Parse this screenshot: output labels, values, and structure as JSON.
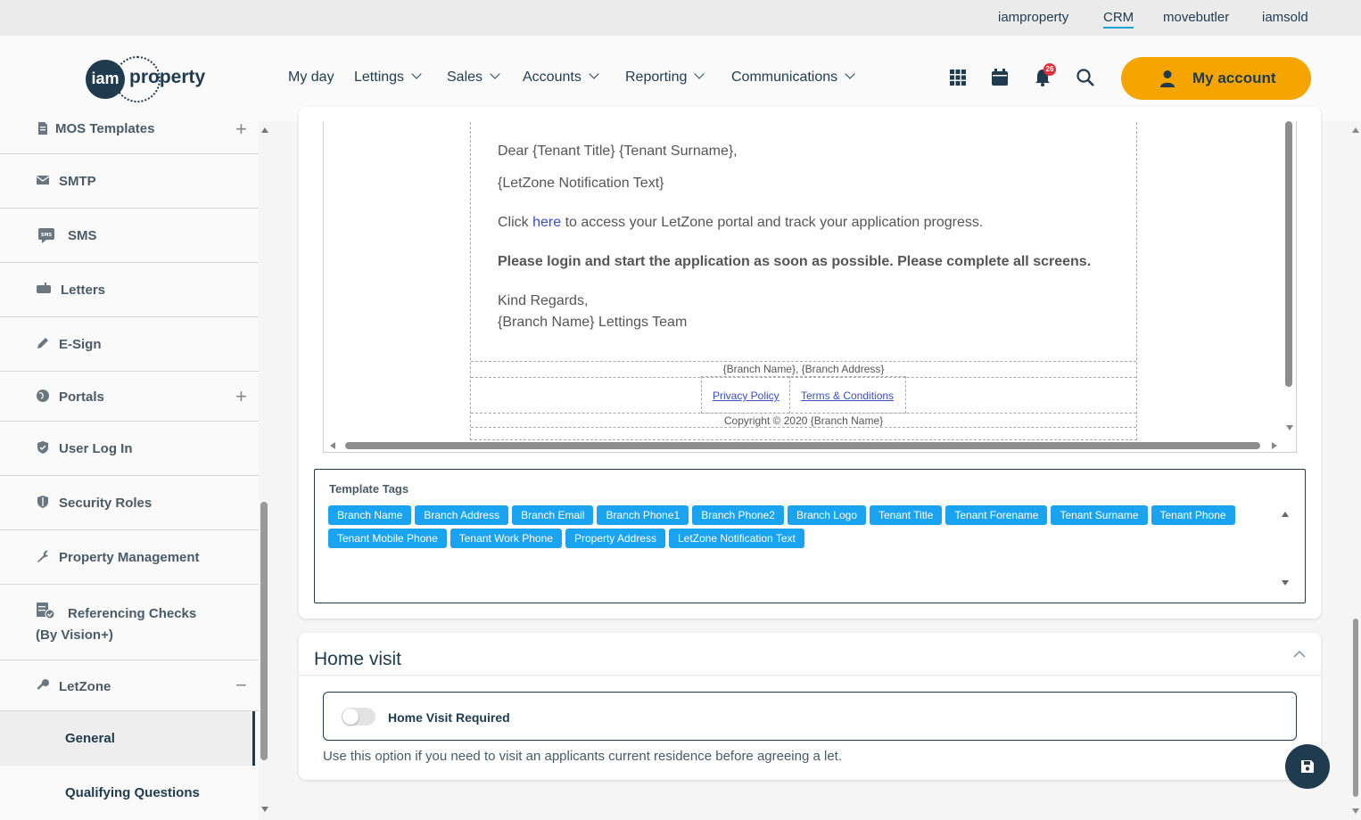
{
  "top_links": [
    {
      "label": "iamproperty",
      "active": false
    },
    {
      "label": "CRM",
      "active": true
    },
    {
      "label": "movebutler",
      "active": false
    },
    {
      "label": "iamsold",
      "active": false
    }
  ],
  "logo": {
    "circle_text": "iam",
    "text": "property"
  },
  "nav": [
    {
      "label": "My day",
      "dropdown": false
    },
    {
      "label": "Lettings",
      "dropdown": true
    },
    {
      "label": "Sales",
      "dropdown": true
    },
    {
      "label": "Accounts",
      "dropdown": true
    },
    {
      "label": "Reporting",
      "dropdown": true
    },
    {
      "label": "Communications",
      "dropdown": true
    }
  ],
  "header_icons": [
    "apps-grid-icon",
    "calendar-icon",
    "bell-icon",
    "search-icon"
  ],
  "notification_count": "26",
  "account_button": {
    "label": "My account",
    "icon": "user-icon"
  },
  "sidebar": {
    "items": [
      {
        "label": "MOS Templates",
        "icon": "document-icon",
        "expand": "+"
      },
      {
        "label": "SMTP",
        "icon": "envelope-icon"
      },
      {
        "label": "SMS",
        "icon": "sms-icon"
      },
      {
        "label": "Letters",
        "icon": "mailbox-icon"
      },
      {
        "label": "E-Sign",
        "icon": "pen-icon"
      },
      {
        "label": "Portals",
        "icon": "globe-icon",
        "expand": "+"
      },
      {
        "label": "User Log In",
        "icon": "shield-check-icon"
      },
      {
        "label": "Security Roles",
        "icon": "shield-icon"
      },
      {
        "label": "Property Management",
        "icon": "wrench-icon"
      },
      {
        "label": "Referencing Checks (By Vision+)",
        "icon": "checklist-icon"
      },
      {
        "label": "LetZone",
        "icon": "key-icon",
        "expand": "−"
      }
    ],
    "subitems": [
      {
        "label": "General",
        "active": true
      },
      {
        "label": "Qualifying Questions",
        "active": false
      }
    ]
  },
  "email_preview": {
    "greeting": "Dear {Tenant Title} {Tenant Surname},",
    "notification": "{LetZone Notification Text}",
    "click_prefix": "Click ",
    "click_link": "here",
    "click_suffix": " to access your LetZone portal and track your application progress.",
    "bold_line": "Please login and start the application as soon as possible. Please complete all screens.",
    "regards": "Kind Regards,",
    "team": "{Branch Name} Lettings Team",
    "footer_address": "{Branch Name}, {Branch Address}",
    "privacy_link": "Privacy Policy",
    "terms_link": "Terms & Conditions",
    "copyright": "Copyright © 2020 {Branch Name}"
  },
  "template_tags": {
    "title": "Template Tags",
    "tags": [
      "Branch Name",
      "Branch Address",
      "Branch Email",
      "Branch Phone1",
      "Branch Phone2",
      "Branch Logo",
      "Tenant Title",
      "Tenant Forename",
      "Tenant Surname",
      "Tenant Phone",
      "Tenant Mobile Phone",
      "Tenant Work Phone",
      "Property Address",
      "LetZone Notification Text"
    ]
  },
  "home_visit": {
    "title": "Home visit",
    "toggle_label": "Home Visit Required",
    "toggle_on": false,
    "help": "Use this option if you need to visit an applicants current residence before agreeing a let."
  },
  "save_icon": "floppy-disk-icon",
  "colors": {
    "navy": "#1f3b4d",
    "orange": "#f6a500",
    "tag_blue": "#1aa3f0",
    "badge_red": "#e0303b"
  }
}
